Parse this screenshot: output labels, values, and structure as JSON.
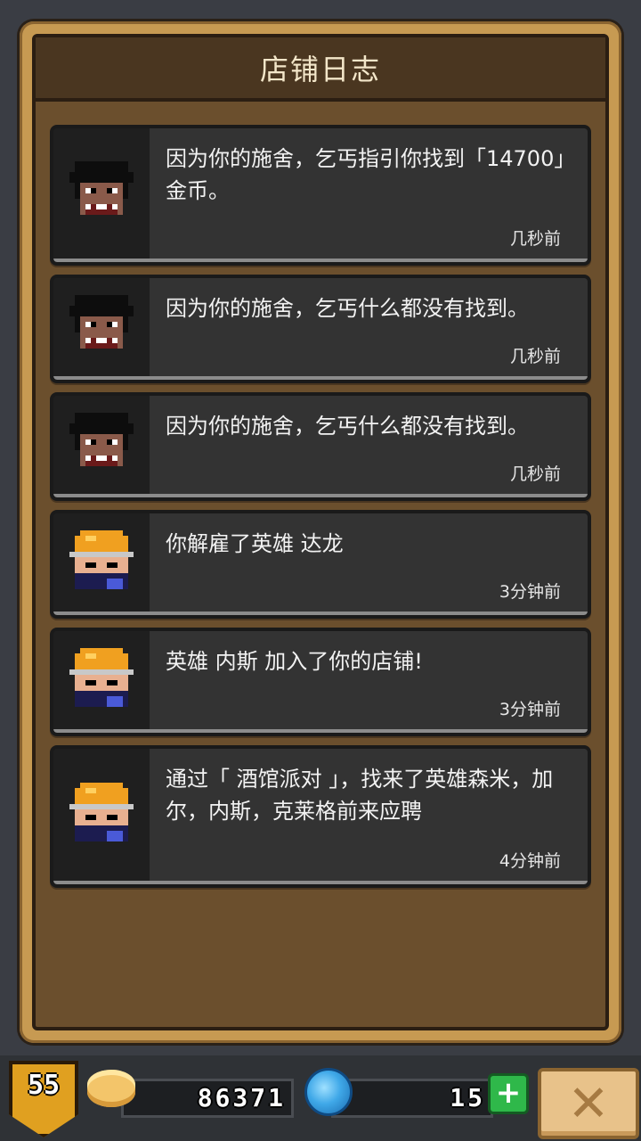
{
  "header": {
    "title": "店铺日志"
  },
  "entries": [
    {
      "portrait": "beggar-portrait-icon",
      "message": "因为你的施舍，乞丐指引你找到「14700」金币。",
      "time": "几秒前"
    },
    {
      "portrait": "beggar-portrait-icon",
      "message": "因为你的施舍，乞丐什么都没有找到。",
      "time": "几秒前"
    },
    {
      "portrait": "beggar-portrait-icon",
      "message": "因为你的施舍，乞丐什么都没有找到。",
      "time": "几秒前"
    },
    {
      "portrait": "hero-portrait-icon",
      "message": "你解雇了英雄 达龙",
      "time": "3分钟前"
    },
    {
      "portrait": "hero-portrait-icon",
      "message": "英雄 内斯 加入了你的店铺!",
      "time": "3分钟前"
    },
    {
      "portrait": "hero-portrait-icon",
      "message": "通过「 酒馆派对 」，找来了英雄森米，加尔，内斯，克莱格前来应聘",
      "time": "4分钟前"
    }
  ],
  "status": {
    "level": "55",
    "gold": "86371",
    "gems": "15",
    "coin_icon": "coin-icon",
    "gem_icon": "gem-icon",
    "plus_icon": "plus-icon",
    "close_icon": "close-icon"
  }
}
